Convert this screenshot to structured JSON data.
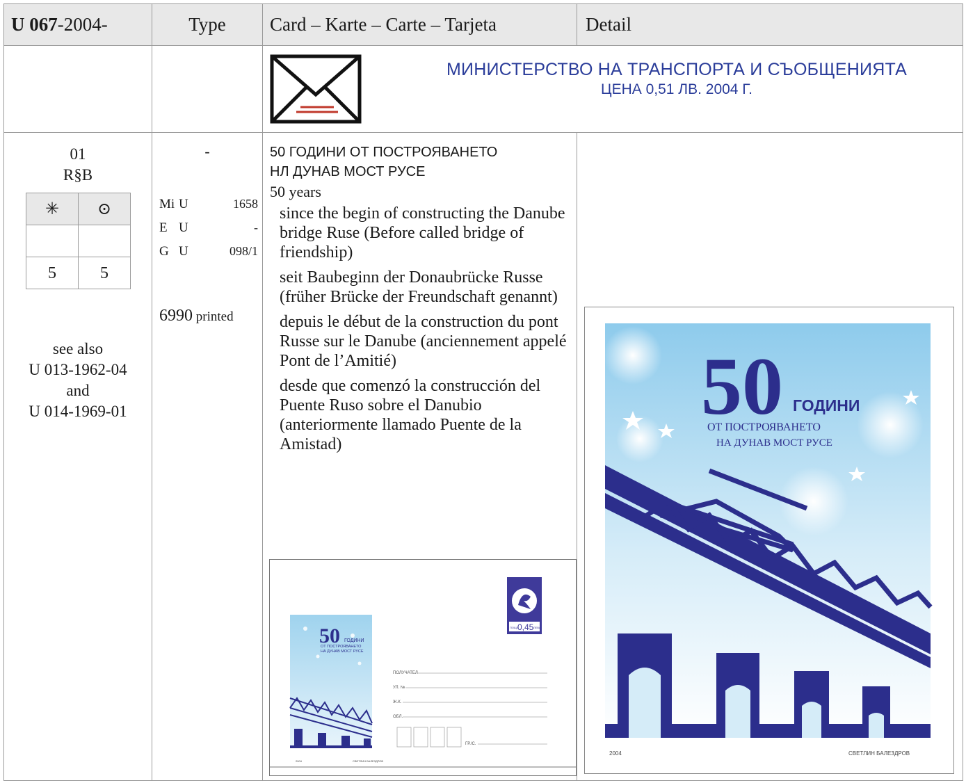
{
  "header": {
    "id_bold": "U 067",
    "id_rest": "-2004-",
    "type": "Type",
    "card": "Card – Karte – Carte – Tarjeta",
    "detail": "Detail"
  },
  "ministry": {
    "line1": "МИНИСТЕРСТВО НА ТРАНСПОРТА И СЪОБЩЕНИЯТА",
    "line2": "ЦЕНА 0,51 ЛВ. 2004 Г."
  },
  "item": {
    "number": "01",
    "rsb": "R§B",
    "mint_symbol": "✳",
    "used_symbol": "⊙",
    "mint_value": "5",
    "used_value": "5",
    "see_also": [
      "see also",
      "U 013-1962-04",
      "and",
      "U 014-1969-01"
    ]
  },
  "catalog": {
    "type_dash": "-",
    "rows": [
      {
        "cat": "Mi",
        "letter": "U",
        "value": "1658"
      },
      {
        "cat": "E",
        "letter": "U",
        "value": "-"
      },
      {
        "cat": "G",
        "letter": "U",
        "value": "098/1"
      }
    ],
    "printed_number": "6990",
    "printed_label": "printed"
  },
  "description": {
    "title_bg_1": "50 ГОДИНИ ОТ ПОСТРОЯВАНЕТО",
    "title_bg_2": "НЛ ДУНАВ МОСТ РУСЕ",
    "lead": "50 years",
    "en": "since the begin of constructing the Danube bridge Ruse (Before called bridge of friendship)",
    "de": "seit Baubeginn der Donaubrücke Russe (früher Brücke der Freund­schaft genannt)",
    "fr": "depuis le début de la construc­tion du pont Russe sur le Danube (anciennement appelé Pont de l’Amitié)",
    "es": "desde que comenzó la construcción del Puente Ruso sobre el Danubio (anteriormente llamado Puente de la Amistad)"
  },
  "envelope": {
    "big": "50",
    "line1": "ГОДИНИ",
    "line2": "ОТ ПОСТРОЯВАНЕТО",
    "line3": "НА ДУНАВ МОСТ РУСЕ",
    "stamp_value": "0,45",
    "stamp_left": "ПОЩА",
    "stamp_right": "ЛЕВА",
    "addr1": "ПОЛУЧАТЕЛ",
    "addr2": "УЛ. №",
    "addr3": "Ж.К.",
    "addr4": "ОБЛ.",
    "postcode": "ГР./С.",
    "year": "2004",
    "artist": "СВЕТЛИН БАЛЕЗДРОВ"
  },
  "detail": {
    "big": "50",
    "line1": "ГОДИНИ",
    "line2": "ОТ ПОСТРОЯВАНЕТО",
    "line3": "НА ДУНАВ МОСТ РУСЕ",
    "year": "2004",
    "artist": "СВЕТЛИН БАЛЕЗДРОВ"
  },
  "colors": {
    "ink_blue": "#2b3d9a",
    "bridge_blue": "#2c2e8c",
    "sky_blue": "#9fd3ee",
    "red": "#c0392b"
  }
}
